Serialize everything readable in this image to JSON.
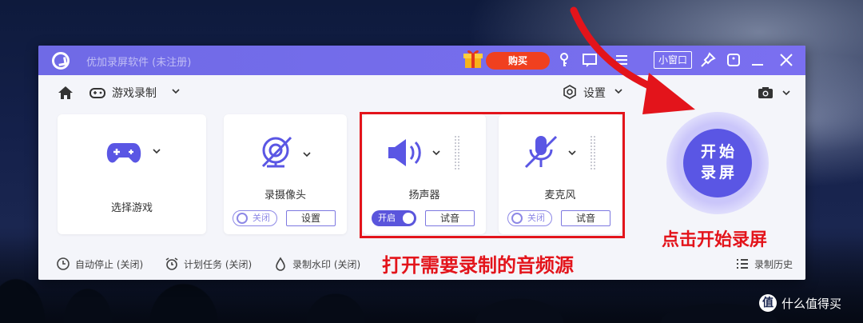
{
  "titlebar": {
    "app_title": "优加录屏软件 (未注册)",
    "buy_label": "购买",
    "mini_window_label": "小窗口",
    "icons": [
      "gift-icon",
      "key-icon",
      "feedback-icon",
      "menu-icon",
      "pin-icon",
      "skin-icon",
      "minimize-icon",
      "close-icon"
    ]
  },
  "toolbar": {
    "mode_label": "游戏录制",
    "settings_label": "设置"
  },
  "cards": {
    "game": {
      "label": "选择游戏"
    },
    "camera": {
      "label": "录摄像头",
      "toggle": "关闭",
      "button": "设置"
    },
    "speaker": {
      "label": "扬声器",
      "toggle": "开启",
      "button": "试音"
    },
    "mic": {
      "label": "麦克风",
      "toggle": "关闭",
      "button": "试音"
    }
  },
  "start_button": {
    "line1": "开始",
    "line2": "录屏"
  },
  "bottom": {
    "auto_stop": "自动停止 (关闭)",
    "schedule": "计划任务 (关闭)",
    "watermark": "录制水印 (关闭)",
    "history": "录制历史"
  },
  "annotations": {
    "audio_source": "打开需要录制的音频源",
    "click_start": "点击开始录屏"
  },
  "site_watermark": {
    "badge": "值",
    "text": "什么值得买"
  },
  "colors": {
    "accent": "#5a56e4",
    "titlebar": "#7a6ff0",
    "buy": "#f0401f",
    "annotation": "#e3141b"
  }
}
